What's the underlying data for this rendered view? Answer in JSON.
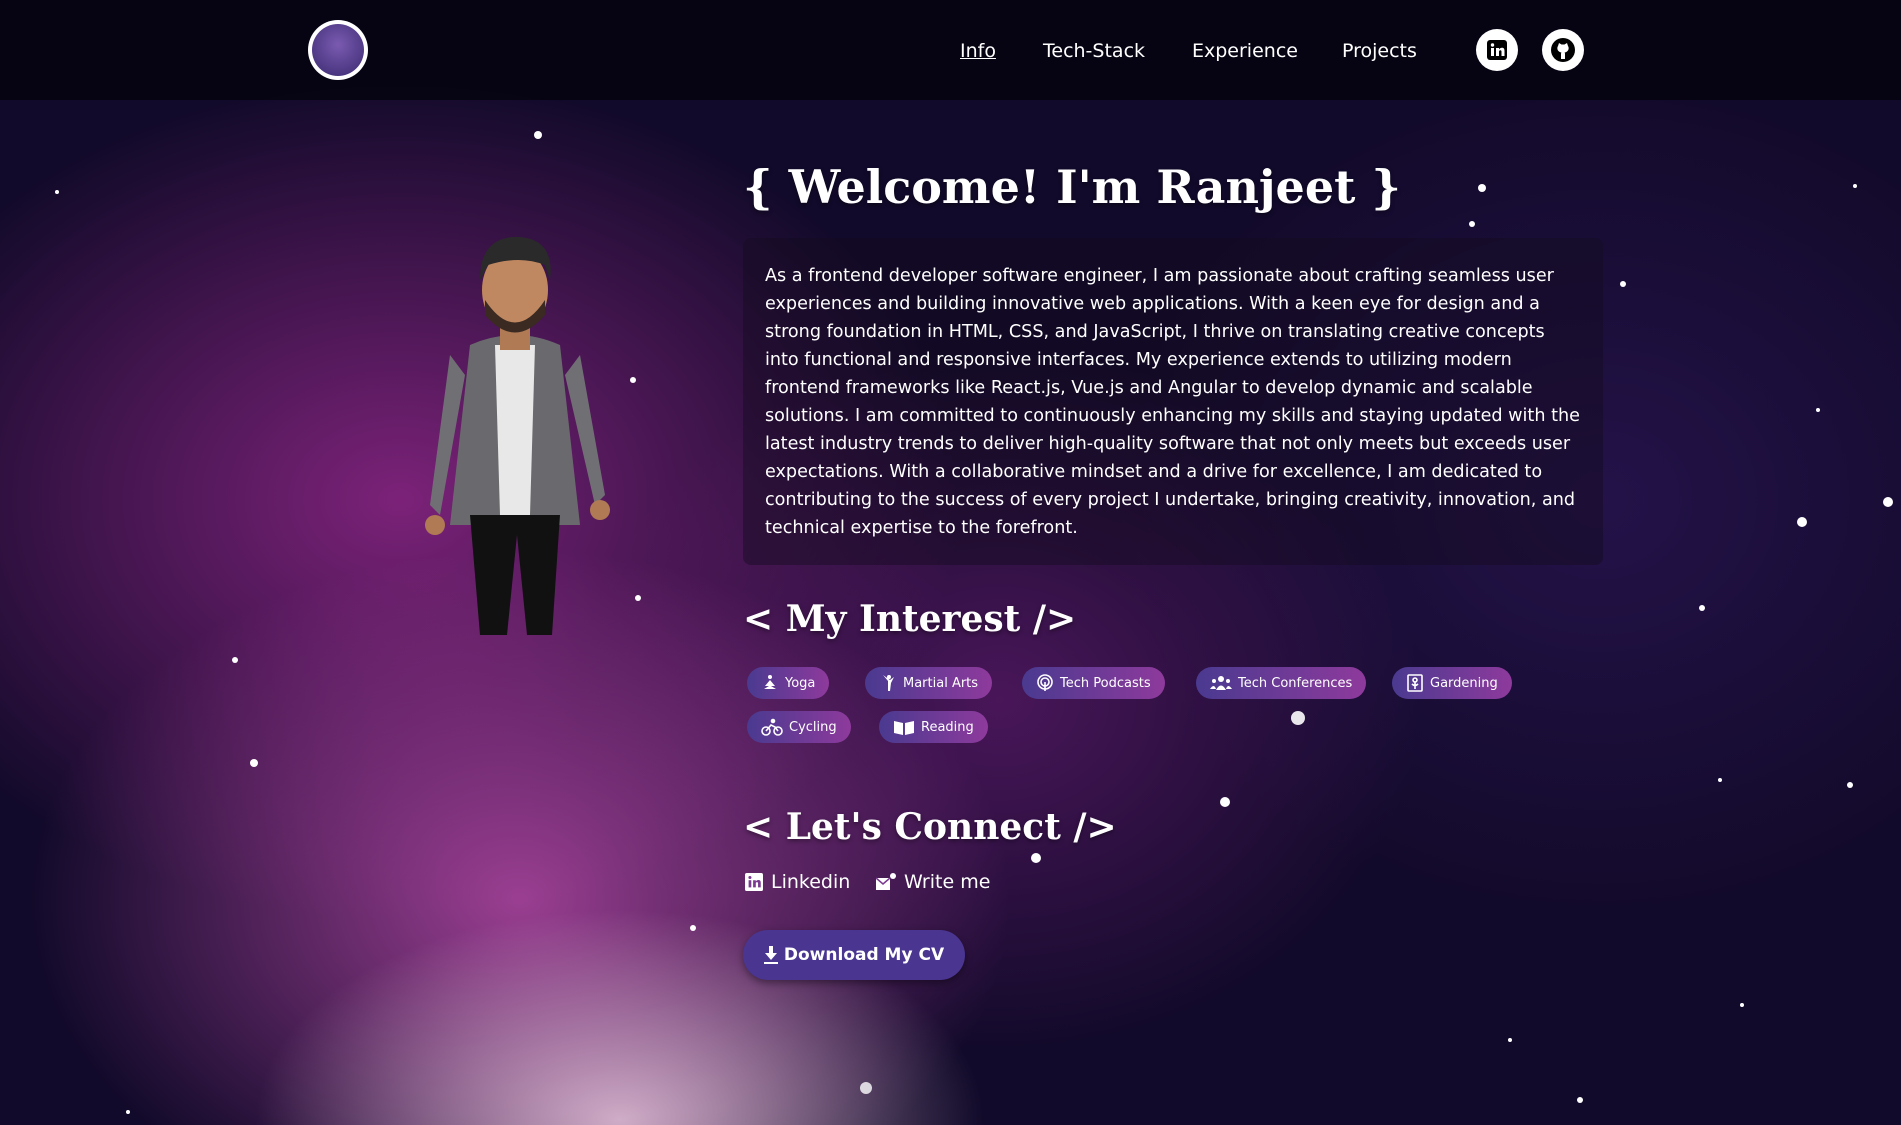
{
  "header": {
    "nav": [
      {
        "label": "Info",
        "active": true
      },
      {
        "label": "Tech-Stack"
      },
      {
        "label": "Experience"
      },
      {
        "label": "Projects"
      }
    ],
    "social": [
      "linkedin-icon",
      "github-icon"
    ]
  },
  "hero": {
    "title": "{ Welcome! I'm Ranjeet }",
    "about": "As a frontend developer software engineer, I am passionate about crafting seamless user experiences and building innovative web applications. With a keen eye for design and a strong foundation in HTML, CSS, and JavaScript, I thrive on translating creative concepts into functional and responsive interfaces. My experience extends to utilizing modern frontend frameworks like React.js, Vue.js and Angular to develop dynamic and scalable solutions. I am committed to continuously enhancing my skills and staying updated with the latest industry trends to deliver high-quality software that not only meets but exceeds user expectations. With a collaborative mindset and a drive for excellence, I am dedicated to contributing to the success of every project I undertake, bringing creativity, innovation, and technical expertise to the forefront."
  },
  "interests": {
    "heading": "< My Interest />",
    "items": [
      {
        "label": "Yoga",
        "icon": "yoga-icon"
      },
      {
        "label": "Martial Arts",
        "icon": "martial-arts-icon"
      },
      {
        "label": "Tech Podcasts",
        "icon": "podcast-icon"
      },
      {
        "label": "Tech Conferences",
        "icon": "people-icon"
      },
      {
        "label": "Gardening",
        "icon": "plant-icon"
      },
      {
        "label": "Cycling",
        "icon": "bicycle-icon"
      },
      {
        "label": "Reading",
        "icon": "book-icon"
      }
    ]
  },
  "connect": {
    "heading": "< Let's Connect />",
    "linkedin": "Linkedin",
    "write": "Write me",
    "cv": "Download My CV"
  },
  "colors": {
    "chip_start": "#4a3a90",
    "chip_end": "#8e3a9c",
    "button": "#4a3590"
  }
}
